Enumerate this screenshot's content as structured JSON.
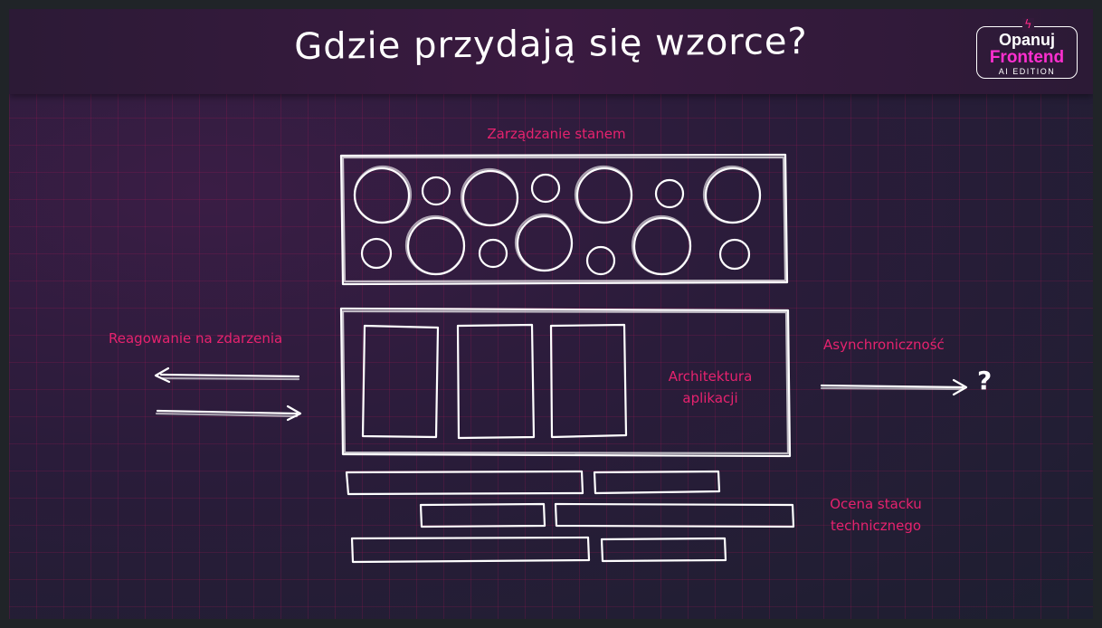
{
  "header": {
    "title": "Gdzie przydają się wzorce?"
  },
  "logo": {
    "line1": "Opanuj",
    "line2": "Frontend",
    "line3": "AI EDITION",
    "bolt_icon": "lightning-icon"
  },
  "labels": {
    "state": "Zarządzanie stanem",
    "events": "Reagowanie na zdarzenia",
    "async": "Asynchroniczność",
    "question": "?",
    "architecture_1": "Architektura",
    "architecture_2": "aplikacji",
    "stack_1": "Ocena stacku",
    "stack_2": "technicznego"
  },
  "colors": {
    "accent": "#e6226e",
    "logo_accent": "#ff2fd0",
    "sketch": "#ffffff"
  }
}
